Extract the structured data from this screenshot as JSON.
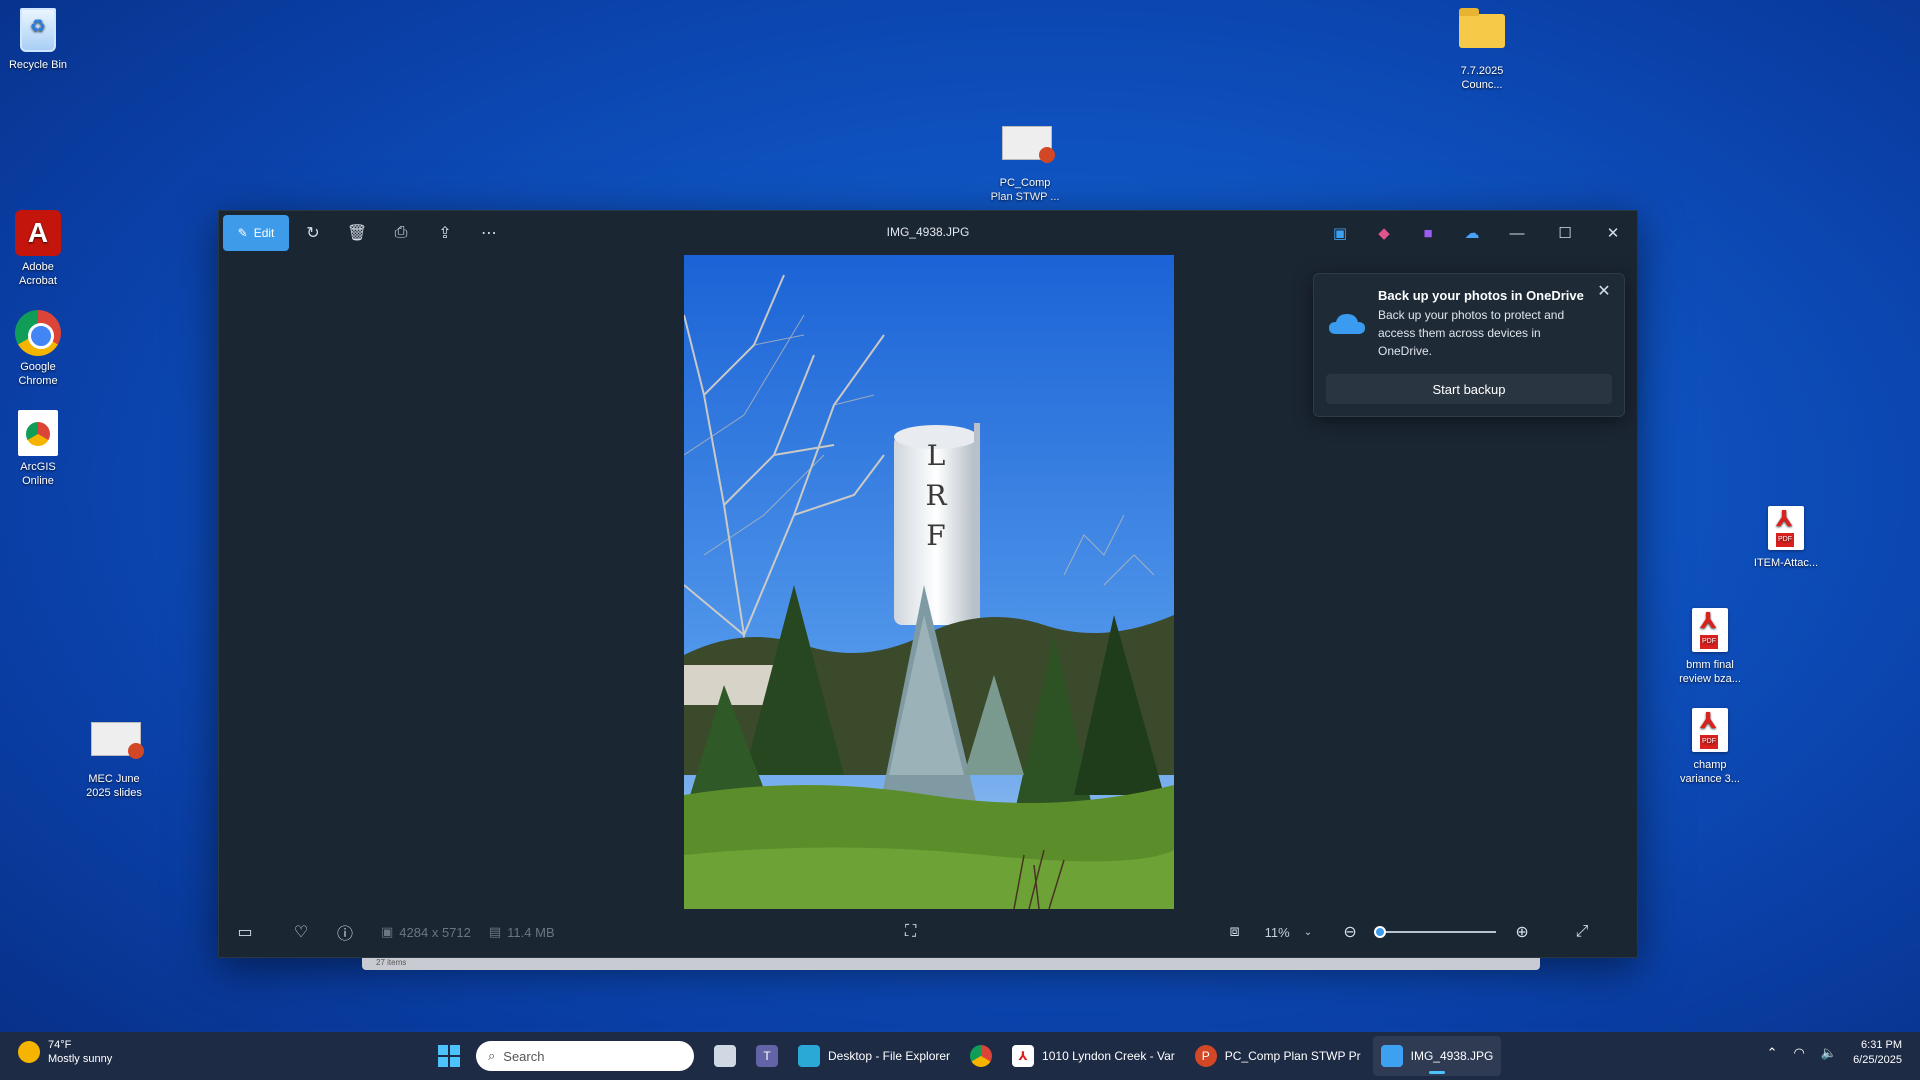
{
  "desktop": {
    "icons": [
      {
        "label": "Recycle Bin"
      },
      {
        "label": "Adobe\nAcrobat"
      },
      {
        "label": "Google\nChrome"
      },
      {
        "label": "ArcGIS\nOnline"
      },
      {
        "label": "MEC June\n2025 slides"
      },
      {
        "label": "PC_Comp\nPlan STWP ..."
      },
      {
        "label": "7.7.2025\nCounc..."
      },
      {
        "label": "ITEM-Attac..."
      },
      {
        "label": "bmm final\nreview bza..."
      },
      {
        "label": "champ\nvariance 3..."
      }
    ]
  },
  "window": {
    "edit_label": "Edit",
    "title": "IMG_4938.JPG",
    "photo_letters": [
      "L",
      "R",
      "F"
    ],
    "toast": {
      "title": "Back up your photos in OneDrive",
      "body": "Back up your photos to protect and access them across devices in OneDrive.",
      "button": "Start backup"
    },
    "bottom": {
      "dimensions": "4284 x 5712",
      "size": "11.4 MB",
      "zoom": "11%",
      "zoom_fraction": 0.03
    },
    "explorer_strip_text": "27 items"
  },
  "taskbar": {
    "weather_temp": "74°F",
    "weather_desc": "Mostly sunny",
    "search_placeholder": "Search",
    "items": [
      {
        "label": "Desktop - File Explorer"
      },
      {
        "label": ""
      },
      {
        "label": "1010 Lyndon Creek - Var"
      },
      {
        "label": "PC_Comp Plan STWP Pr"
      },
      {
        "label": "IMG_4938.JPG"
      }
    ],
    "time": "6:31 PM",
    "date": "6/25/2025"
  },
  "colors": {
    "accent": "#3d9be9",
    "window_bg": "#1b2633",
    "taskbar_bg": "#1e2b45"
  }
}
